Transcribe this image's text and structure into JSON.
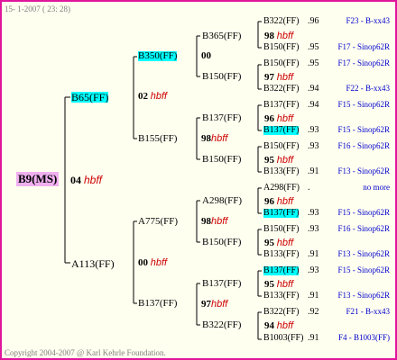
{
  "header": "15- 1-2007 ( 23: 28)",
  "footer": "Copyright 2004-2007 @ Karl Kehrle Foundation.",
  "root": {
    "label": "B9(MS)"
  },
  "gen1": [
    {
      "label": "B65(FF)"
    },
    {
      "num": "04",
      "note": "hbff"
    },
    {
      "label": "A113(FF)"
    }
  ],
  "gen2": [
    {
      "label": "B350(FF)"
    },
    {
      "num": "02",
      "note": "hbff"
    },
    {
      "label": "B155(FF)"
    },
    {
      "label": "A775(FF)"
    },
    {
      "num": "00",
      "note": "hbff"
    },
    {
      "label": "B137(FF)"
    }
  ],
  "gen3": [
    {
      "label": "B365(FF)"
    },
    {
      "num": "00",
      "note": ""
    },
    {
      "label": "B150(FF)"
    },
    {
      "label": "B137(FF)"
    },
    {
      "num": "98",
      "note": "hbff"
    },
    {
      "label": "B150(FF)"
    },
    {
      "label": "A298(FF)"
    },
    {
      "num": "98",
      "note": "hbff"
    },
    {
      "label": "B150(FF)"
    },
    {
      "label": "B137(FF)"
    },
    {
      "num": "97",
      "note": "hbff"
    },
    {
      "label": "B322(FF)"
    }
  ],
  "gen4": [
    {
      "label": "B322(FF)",
      "val": ".96",
      "note": "F23 - B-xx43"
    },
    {
      "num": "98",
      "note": "hbff"
    },
    {
      "label": "B150(FF)",
      "val": ".95",
      "note": "F17 - Sinop62R"
    },
    {
      "label": "B150(FF)",
      "val": ".95",
      "note": "F17 - Sinop62R"
    },
    {
      "num": "97",
      "note": "hbff"
    },
    {
      "label": "B322(FF)",
      "val": ".94",
      "note": "F22 - B-xx43"
    },
    {
      "label": "B137(FF)",
      "val": ".94",
      "note": "F15 - Sinop62R"
    },
    {
      "num": "96",
      "note": "hbff"
    },
    {
      "label": "B137(FF)",
      "val": ".93",
      "note": "F15 - Sinop62R"
    },
    {
      "label": "B150(FF)",
      "val": ".93",
      "note": "F16 - Sinop62R"
    },
    {
      "num": "95",
      "note": "hbff"
    },
    {
      "label": "B133(FF)",
      "val": ".91",
      "note": "F13 - Sinop62R"
    },
    {
      "label": "A298(FF)",
      "val": ".",
      "note": "no more"
    },
    {
      "num": "96",
      "note": "hbff"
    },
    {
      "label": "B137(FF)",
      "val": ".93",
      "note": "F15 - Sinop62R"
    },
    {
      "label": "B150(FF)",
      "val": ".93",
      "note": "F16 - Sinop62R"
    },
    {
      "num": "95",
      "note": "hbff"
    },
    {
      "label": "B133(FF)",
      "val": ".91",
      "note": "F13 - Sinop62R"
    },
    {
      "label": "B137(FF)",
      "val": ".93",
      "note": "F15 - Sinop62R"
    },
    {
      "num": "95",
      "note": "hbff"
    },
    {
      "label": "B133(FF)",
      "val": ".91",
      "note": "F13 - Sinop62R"
    },
    {
      "label": "B322(FF)",
      "val": ".92",
      "note": "F21 - B-xx43"
    },
    {
      "num": "94",
      "note": "hbff"
    },
    {
      "label": "B1003(FF)",
      "val": ".91",
      "note": "F4 - B1003(FF)"
    }
  ]
}
